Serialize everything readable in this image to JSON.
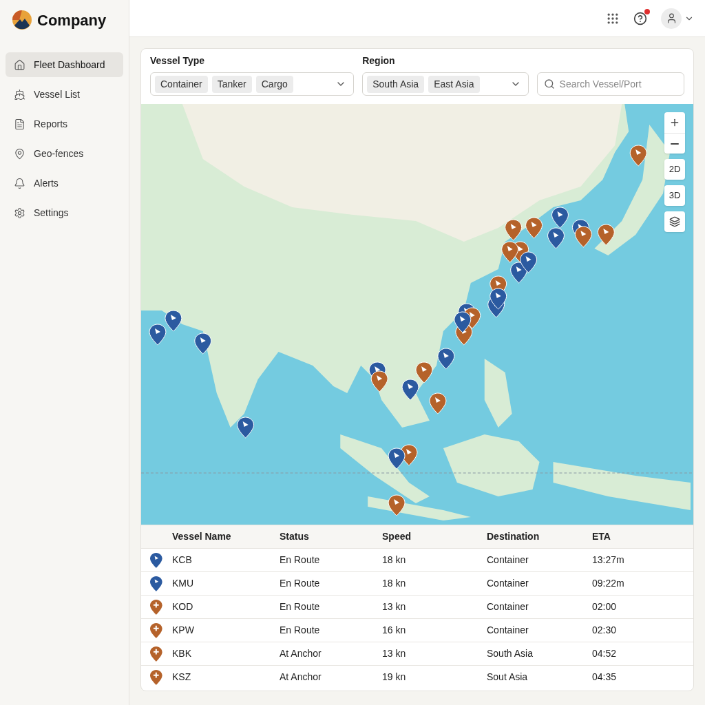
{
  "brand": {
    "name": "Company"
  },
  "sidebar": {
    "items": [
      {
        "label": "Fleet Dashboard",
        "selected": true
      },
      {
        "label": "Vessel List",
        "selected": false
      },
      {
        "label": "Reports",
        "selected": false
      },
      {
        "label": "Geo-fences",
        "selected": false
      },
      {
        "label": "Alerts",
        "selected": false
      },
      {
        "label": "Settings",
        "selected": false
      }
    ]
  },
  "header": {
    "help_notification": true
  },
  "filters": {
    "vessel_type": {
      "label": "Vessel Type",
      "chips": [
        "Container",
        "Tanker",
        "Cargo"
      ]
    },
    "region": {
      "label": "Region",
      "chips": [
        "South Asia",
        "East Asia"
      ]
    },
    "search": {
      "placeholder": "Search Vessel/Port"
    }
  },
  "map": {
    "view_buttons": [
      {
        "label": "2D",
        "selected": false
      },
      {
        "label": "3D",
        "selected": false
      }
    ]
  },
  "table": {
    "columns": [
      "Vessel Name",
      "Status",
      "Speed",
      "Destination",
      "ETA"
    ],
    "rows": [
      {
        "kind": "flag",
        "color": "#2b5aa0",
        "cells": [
          "KCB",
          "En Route",
          "18 kn",
          "Container",
          "13:27m"
        ]
      },
      {
        "kind": "flag",
        "color": "#2b5aa0",
        "cells": [
          "KMU",
          "En Route",
          "18 kn",
          "Container",
          "09:22m"
        ]
      },
      {
        "kind": "plus",
        "color": "#b5622a",
        "cells": [
          "KOD",
          "En Route",
          "13 kn",
          "Container",
          "02:00"
        ]
      },
      {
        "kind": "plus",
        "color": "#b5622a",
        "cells": [
          "KPW",
          "En Route",
          "16 kn",
          "Container",
          "02:30"
        ]
      },
      {
        "kind": "plus",
        "color": "#b5622a",
        "cells": [
          "KBK",
          "At Anchor",
          "13 kn",
          "South Asia",
          "04:52"
        ]
      },
      {
        "kind": "plus",
        "color": "#b5622a",
        "cells": [
          "KSZ",
          "At Anchor",
          "19 kn",
          "Sout Asia",
          "04:35"
        ]
      }
    ]
  }
}
